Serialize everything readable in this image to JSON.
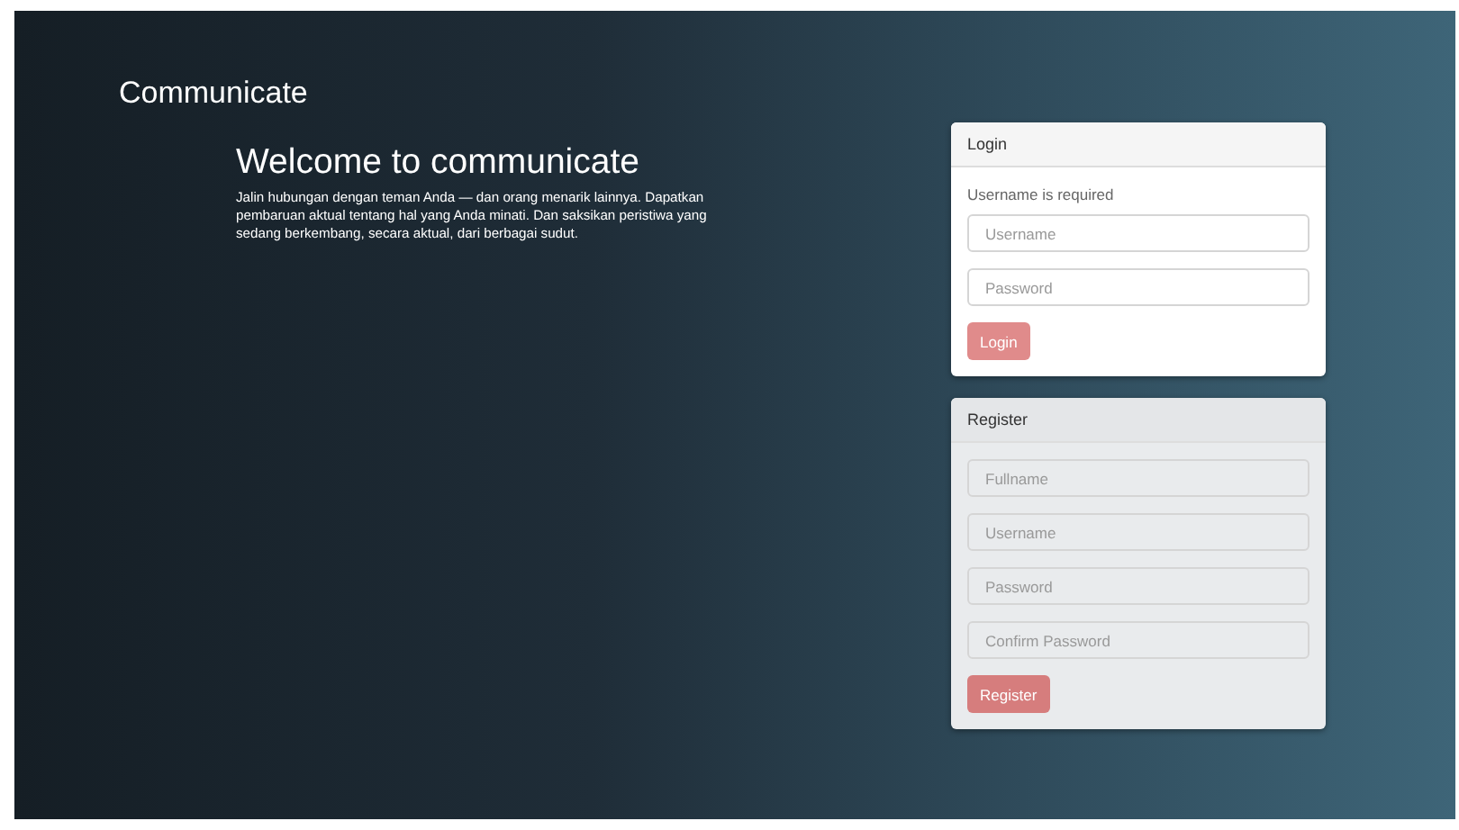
{
  "brand": "Communicate",
  "welcome": {
    "heading": "Welcome to communicate",
    "text": "Jalin hubungan dengan teman Anda — dan orang menarik lainnya. Dapatkan pembaruan aktual tentang hal yang Anda minati. Dan saksikan peristiwa yang sedang berkembang, secara aktual, dari berbagai sudut."
  },
  "panels": [
    {
      "title": "Login",
      "disabled": false,
      "error": "Username is required",
      "fields": [
        {
          "placeholder": "Username"
        },
        {
          "placeholder": "Password"
        }
      ],
      "button": "Login"
    },
    {
      "title": "Register",
      "disabled": true,
      "fields": [
        {
          "placeholder": "Fullname"
        },
        {
          "placeholder": "Username"
        },
        {
          "placeholder": "Password"
        },
        {
          "placeholder": "Confirm Password"
        }
      ],
      "button": "Register"
    }
  ]
}
